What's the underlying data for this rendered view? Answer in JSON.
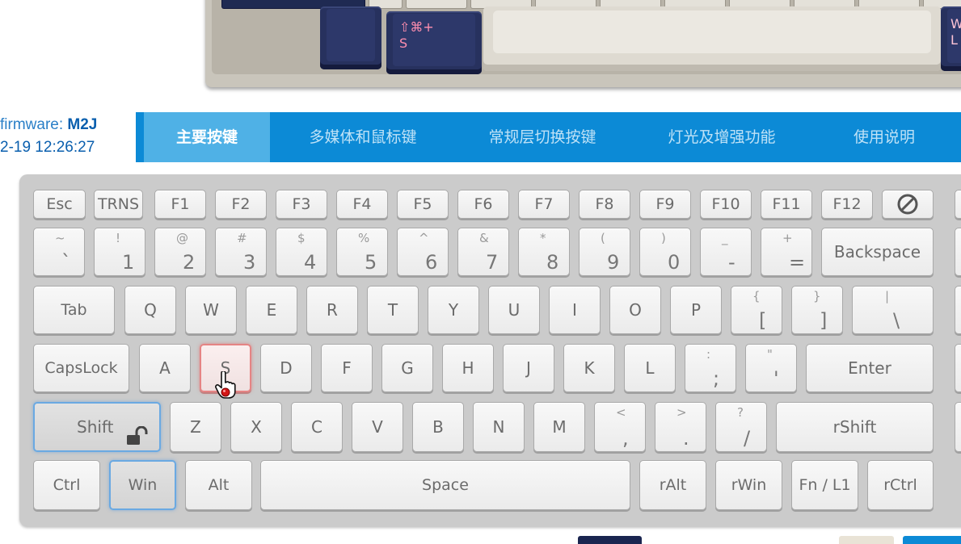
{
  "preview": {
    "shift_cmd_s": "⇧⌘+\nS",
    "right_partial": "W\nL"
  },
  "info": {
    "firmware_label": "firmware: ",
    "firmware_value": "M2J",
    "timestamp": "2-19 12:26:27"
  },
  "tabs": [
    {
      "label": "主要按键",
      "active": true
    },
    {
      "label": "多媒体和鼠标键",
      "active": false
    },
    {
      "label": "常规层切换按键",
      "active": false
    },
    {
      "label": "灯光及增强功能",
      "active": false
    },
    {
      "label": "使用说明",
      "active": false
    }
  ],
  "keyboard": {
    "row1": [
      "Esc",
      "TRNS",
      "F1",
      "F2",
      "F3",
      "F4",
      "F5",
      "F6",
      "F7",
      "F8",
      "F9",
      "F10",
      "F11",
      "F12"
    ],
    "row1_blocked_icon": "no-entry-icon",
    "row2": [
      {
        "shift": "~",
        "main": "`"
      },
      {
        "shift": "!",
        "main": "1"
      },
      {
        "shift": "@",
        "main": "2"
      },
      {
        "shift": "#",
        "main": "3"
      },
      {
        "shift": "$",
        "main": "4"
      },
      {
        "shift": "%",
        "main": "5"
      },
      {
        "shift": "^",
        "main": "6"
      },
      {
        "shift": "&",
        "main": "7"
      },
      {
        "shift": "*",
        "main": "8"
      },
      {
        "shift": "(",
        "main": "9"
      },
      {
        "shift": ")",
        "main": "0"
      },
      {
        "shift": "_",
        "main": "-"
      },
      {
        "shift": "+",
        "main": "="
      }
    ],
    "backspace": "Backspace",
    "tab": "Tab",
    "row3": [
      "Q",
      "W",
      "E",
      "R",
      "T",
      "Y",
      "U",
      "I",
      "O",
      "P"
    ],
    "row3_dual": [
      {
        "shift": "{",
        "main": "["
      },
      {
        "shift": "}",
        "main": "]"
      },
      {
        "shift": "|",
        "main": "\\"
      }
    ],
    "capslock": "CapsLock",
    "row4": [
      "A",
      "S",
      "D",
      "F",
      "G",
      "H",
      "J",
      "K",
      "L"
    ],
    "row4_dual": [
      {
        "shift": ":",
        "main": ";"
      },
      {
        "shift": "\"",
        "main": "'"
      }
    ],
    "enter": "Enter",
    "shift": "Shift",
    "row5": [
      "Z",
      "X",
      "C",
      "V",
      "B",
      "N",
      "M"
    ],
    "row5_dual": [
      {
        "shift": "<",
        "main": ","
      },
      {
        "shift": ">",
        "main": "."
      },
      {
        "shift": "?",
        "main": "/"
      }
    ],
    "rshift": "rShift",
    "row6": [
      "Ctrl",
      "Win",
      "Alt",
      "Space",
      "rAlt",
      "rWin",
      "Fn / L1",
      "rCtrl"
    ],
    "selected_key": "S",
    "active_keys": [
      "Shift",
      "Win"
    ]
  },
  "colors": {
    "tab_bar": "#0c8ad6",
    "tab_active": "#4fb1e6",
    "selected_border": "#e58484",
    "active_border": "#6aa9e2",
    "navy_keycap": "#27315e"
  }
}
